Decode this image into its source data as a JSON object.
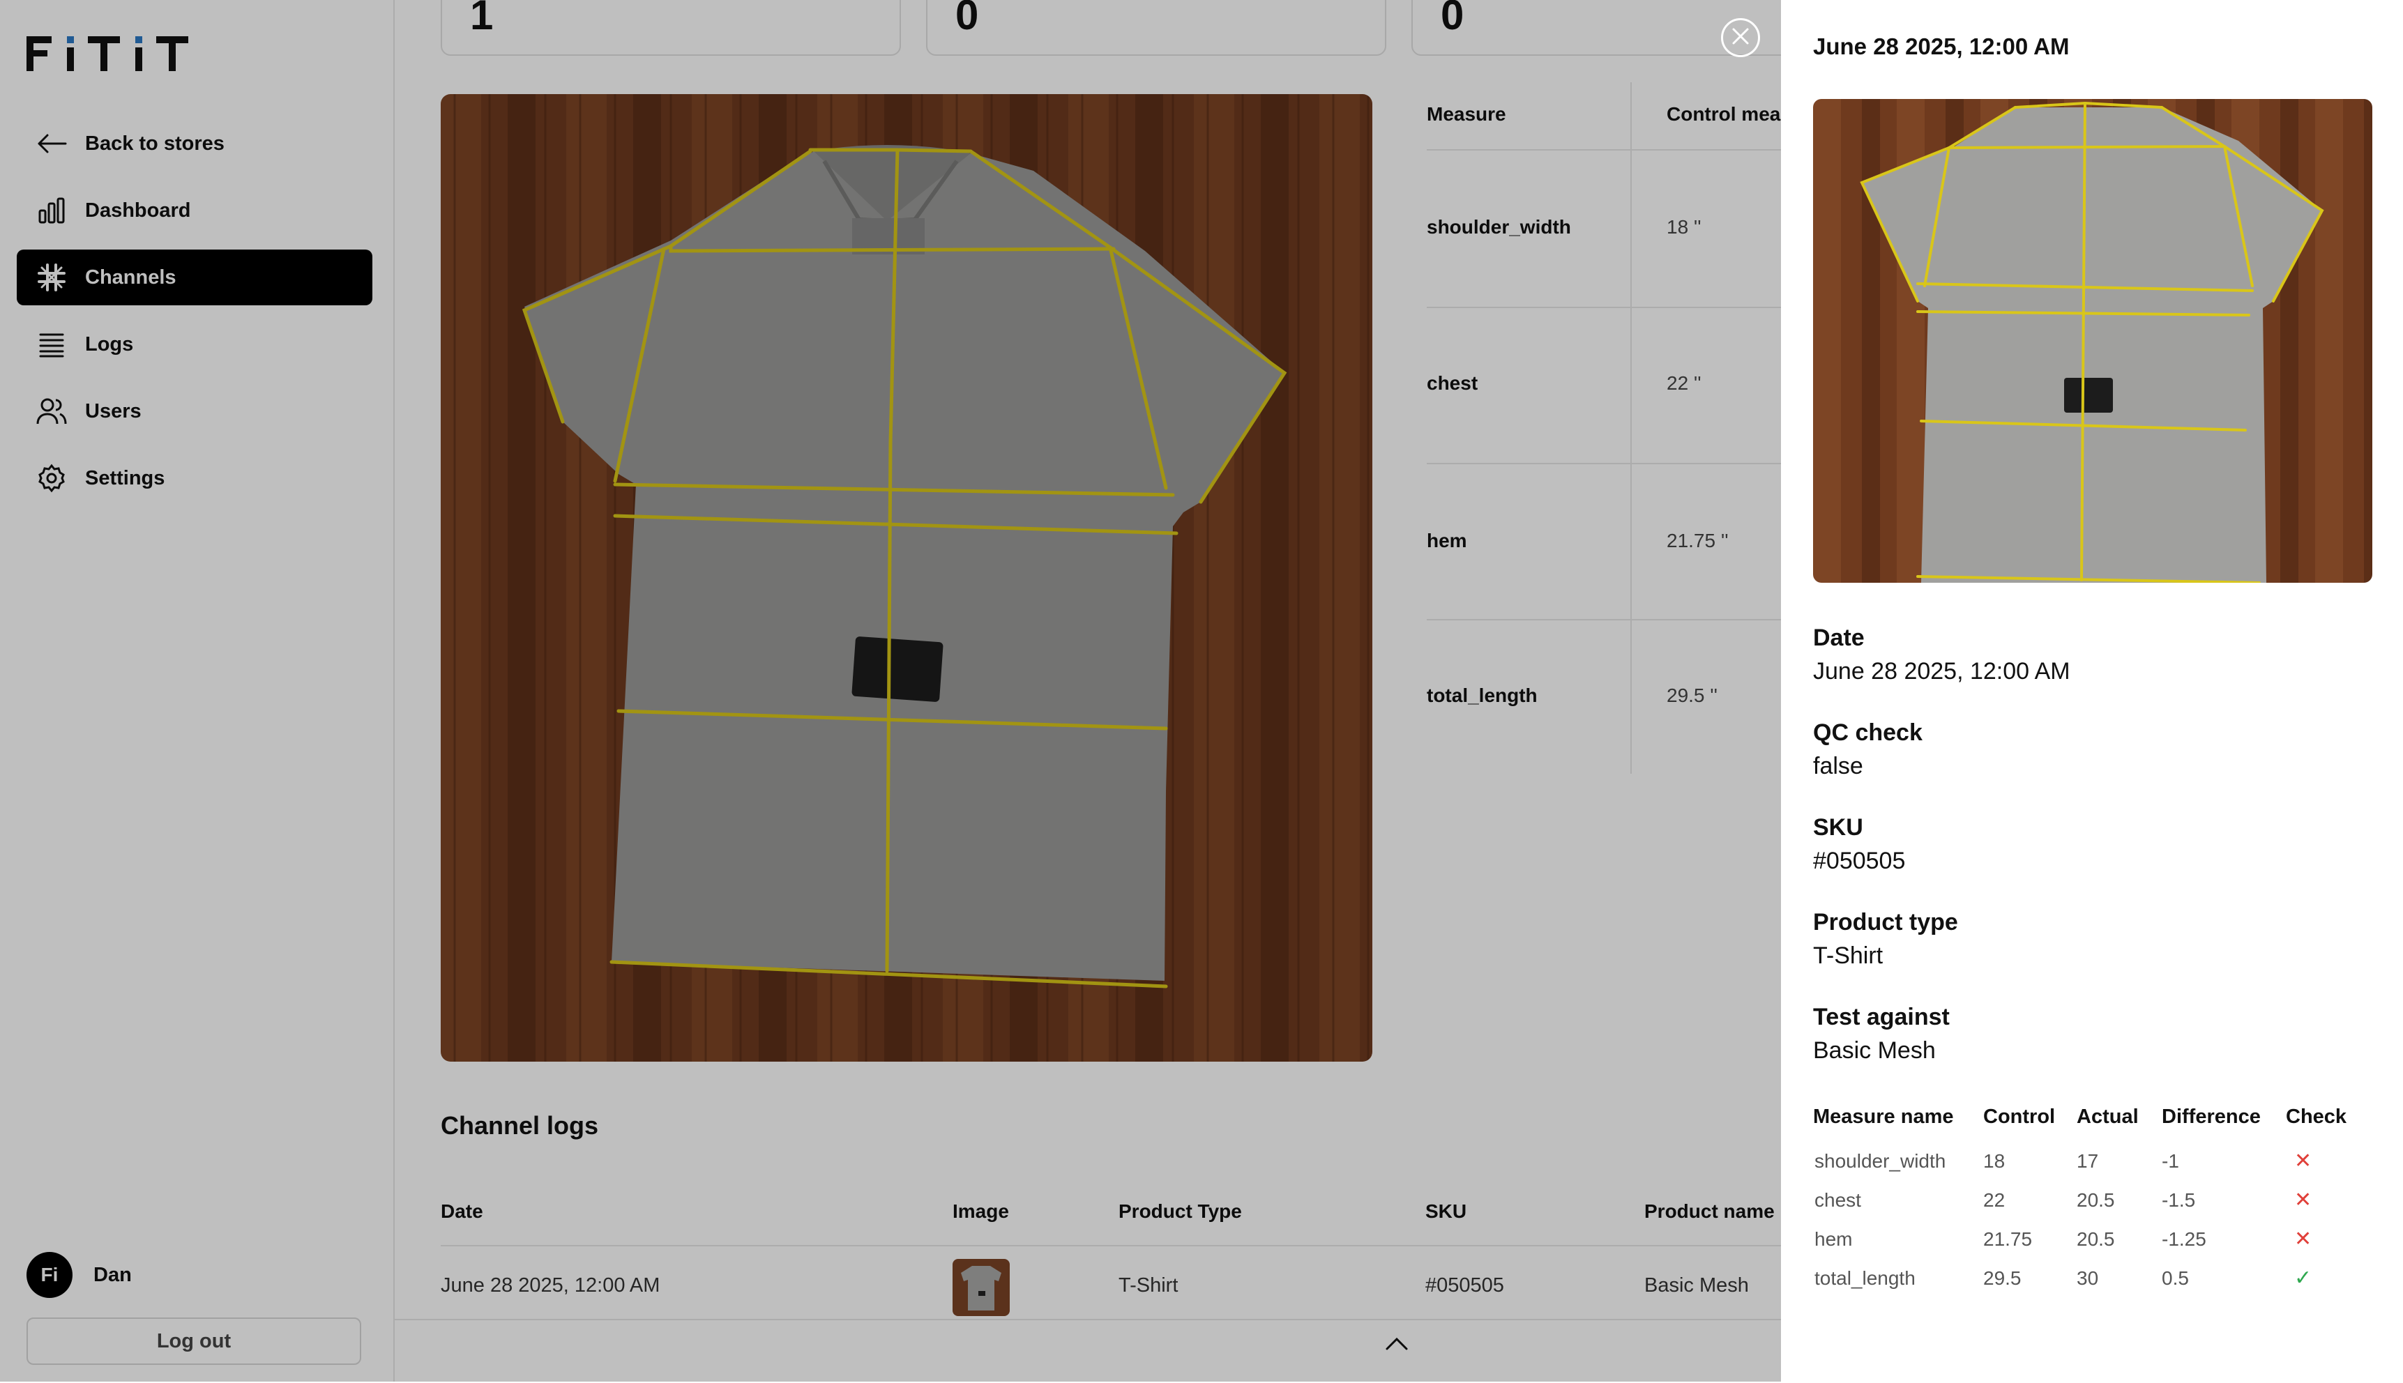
{
  "brand": {
    "logo_text": "FiTiT"
  },
  "sidebar": {
    "items": [
      {
        "label": "Back to stores",
        "icon": "arrow-left-icon"
      },
      {
        "label": "Dashboard",
        "icon": "bar-chart-icon"
      },
      {
        "label": "Channels",
        "icon": "channels-icon",
        "active": true
      },
      {
        "label": "Logs",
        "icon": "logs-icon"
      },
      {
        "label": "Users",
        "icon": "users-icon"
      },
      {
        "label": "Settings",
        "icon": "gear-icon"
      }
    ],
    "user": {
      "avatar_initials": "Fi",
      "name": "Dan"
    },
    "logout_label": "Log out"
  },
  "stats": [
    "1",
    "0",
    "0"
  ],
  "measure_table": {
    "headers": [
      "Measure",
      "Control mea"
    ],
    "rows": [
      {
        "measure": "shoulder_width",
        "control": "18 ''"
      },
      {
        "measure": "chest",
        "control": "22 ''"
      },
      {
        "measure": "hem",
        "control": "21.75 ''"
      },
      {
        "measure": "total_length",
        "control": "29.5 ''"
      }
    ]
  },
  "channel_logs": {
    "title": "Channel logs",
    "headers": [
      "Date",
      "Image",
      "Product Type",
      "SKU",
      "Product name"
    ],
    "rows": [
      {
        "date": "June 28 2025, 12:00 AM",
        "product_type": "T-Shirt",
        "sku": "#050505",
        "product_name": "Basic Mesh"
      }
    ]
  },
  "drawer": {
    "title": "June 28 2025, 12:00 AM",
    "fields": [
      {
        "label": "Date",
        "value": "June 28 2025, 12:00 AM"
      },
      {
        "label": "QC check",
        "value": "false"
      },
      {
        "label": "SKU",
        "value": "#050505"
      },
      {
        "label": "Product type",
        "value": "T-Shirt"
      },
      {
        "label": "Test against",
        "value": "Basic Mesh"
      }
    ],
    "qc_table": {
      "headers": [
        "Measure name",
        "Control",
        "Actual",
        "Difference",
        "Check"
      ],
      "rows": [
        {
          "name": "shoulder_width",
          "control": "18",
          "actual": "17",
          "difference": "-1",
          "check": "✕"
        },
        {
          "name": "chest",
          "control": "22",
          "actual": "20.5",
          "difference": "-1.5",
          "check": "✕"
        },
        {
          "name": "hem",
          "control": "21.75",
          "actual": "20.5",
          "difference": "-1.25",
          "check": "✕"
        },
        {
          "name": "total_length",
          "control": "29.5",
          "actual": "30",
          "difference": "0.5",
          "check": "✓"
        }
      ]
    }
  },
  "colors": {
    "fail": "#e0403a",
    "pass": "#2fa84f",
    "accent": "#000000",
    "measure_line": "#d9c619"
  }
}
